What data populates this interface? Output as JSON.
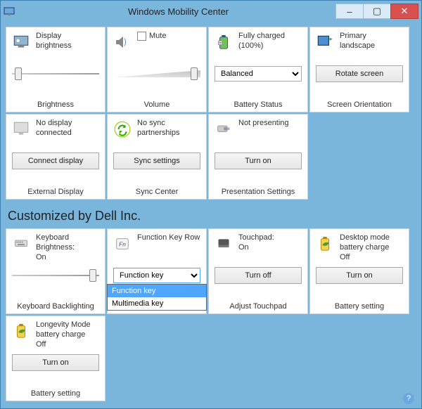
{
  "window": {
    "title": "Windows Mobility Center"
  },
  "tiles": {
    "brightness": {
      "label1": "Display",
      "label2": "brightness",
      "footer": "Brightness"
    },
    "volume": {
      "mute_label": "Mute",
      "footer": "Volume"
    },
    "battery": {
      "label1": "Fully charged",
      "label2": "(100%)",
      "select": "Balanced",
      "footer": "Battery Status"
    },
    "screen": {
      "label1": "Primary",
      "label2": "landscape",
      "button": "Rotate screen",
      "footer": "Screen Orientation"
    },
    "extdisp": {
      "label1": "No display",
      "label2": "connected",
      "button": "Connect display",
      "footer": "External Display"
    },
    "sync": {
      "label1": "No sync",
      "label2": "partnerships",
      "button": "Sync settings",
      "footer": "Sync Center"
    },
    "present": {
      "label1": "Not presenting",
      "button": "Turn on",
      "footer": "Presentation Settings"
    }
  },
  "section_header": "Customized by Dell Inc.",
  "dell": {
    "kbdbright": {
      "label1": "Keyboard",
      "label2": "Brightness:",
      "label3": "On",
      "footer": "Keyboard Backlighting"
    },
    "fnkey": {
      "label1": "Function Key Row",
      "select": "Function key",
      "options": [
        "Function key",
        "Multimedia key"
      ]
    },
    "touchpad": {
      "label1": "Touchpad:",
      "label2": "On",
      "button": "Turn off",
      "footer": "Adjust Touchpad"
    },
    "deskbatt": {
      "label1": "Desktop mode",
      "label2": "battery charge",
      "label3": "Off",
      "button": "Turn on",
      "footer": "Battery setting"
    },
    "longevity": {
      "label1": "Longevity Mode",
      "label2": "battery charge",
      "label3": "Off",
      "button": "Turn on",
      "footer": "Battery setting"
    }
  }
}
